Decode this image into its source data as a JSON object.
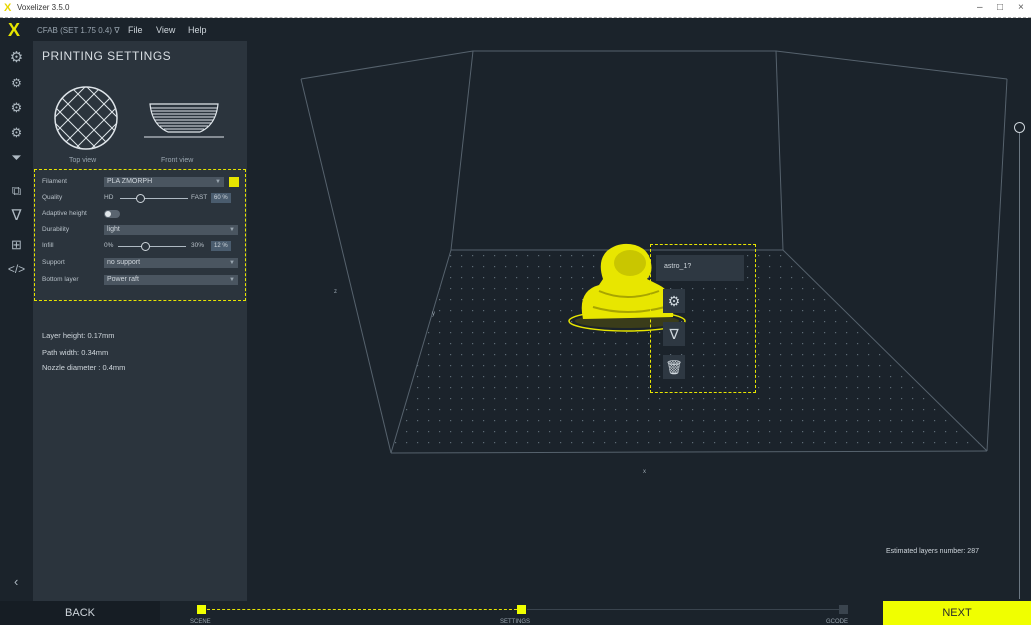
{
  "window": {
    "title": "Voxelizer 3.5.0"
  },
  "menubar": {
    "printer": "CFAB (SET 1.75 0.4) ∇",
    "items": [
      "File",
      "View",
      "Help"
    ]
  },
  "rail_icons": [
    "gear-icon",
    "gear-plus-icon",
    "gear-node-icon",
    "gear-layers-icon",
    "funnel-layers-icon",
    "copy-icon",
    "funnel-icon",
    "network-icon",
    "code-icon"
  ],
  "panel": {
    "title": "PRINTING SETTINGS",
    "top_view_label": "Top view",
    "front_view_label": "Front view",
    "settings": {
      "filament_label": "Filament",
      "filament_value": "PLA ZMORPH",
      "filament_color": "#e8e600",
      "quality_label": "Quality",
      "quality_min": "HD",
      "quality_max": "FAST",
      "quality_value": "60 %",
      "quality_fraction": 0.3,
      "adaptive_label": "Adaptive height",
      "durability_label": "Durability",
      "durability_value": "light",
      "infill_label": "Infill",
      "infill_min": "0%",
      "infill_max": "30%",
      "infill_value": "12 %",
      "support_label": "Support",
      "support_value": "no support",
      "bottom_label": "Bottom layer",
      "bottom_value": "Power raft"
    },
    "info": {
      "layer_height": "Layer height: 0.17mm",
      "path_width": "Path width: 0.34mm",
      "nozzle": "Nozzle diameter : 0.4mm"
    }
  },
  "viewport": {
    "object_name": "astro_1?",
    "estimated_layers": "Estimated layers number: 287",
    "axis_z": "z",
    "axis_y": "y",
    "axis_x": "x"
  },
  "bottombar": {
    "back": "BACK",
    "next": "NEXT",
    "steps": [
      "SCENE",
      "SETTINGS",
      "GCODE"
    ]
  }
}
